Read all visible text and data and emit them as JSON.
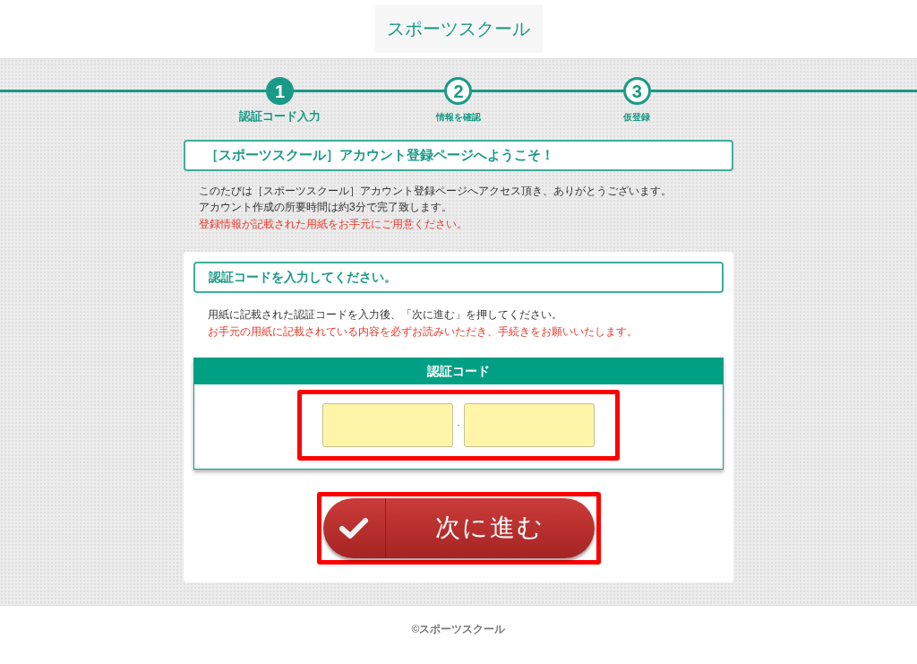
{
  "header": {
    "logo": "スポーツスクール"
  },
  "steps": [
    {
      "number": "1",
      "label": "認証コード入力",
      "selected": true
    },
    {
      "number": "2",
      "label": "情報を確認",
      "selected": false
    },
    {
      "number": "3",
      "label": "仮登録",
      "selected": false
    }
  ],
  "welcome": {
    "title": "［スポーツスクール］アカウント登録ページへようこそ！",
    "lines": [
      "このたびは［スポーツスクール］アカウント登録ページへアクセス頂き、ありがとうございます。",
      "アカウント作成の所要時間は約3分で完了致します。"
    ],
    "notice": "登録情報が記載された用紙をお手元にご用意ください。"
  },
  "form": {
    "title": "認証コードを入力してください。",
    "instruction": "用紙に記載された認証コードを入力後、「次に進む」を押してください。",
    "notice": "お手元の用紙に記載されている内容を必ずお読みいただき、手続きをお願いいたします。",
    "code": {
      "heading": "認証コード",
      "separator": "-",
      "highlighted": true
    },
    "submit": {
      "label": "次に進む",
      "highlighted": true
    }
  },
  "footer": {
    "copyright": "©スポーツスクール"
  }
}
